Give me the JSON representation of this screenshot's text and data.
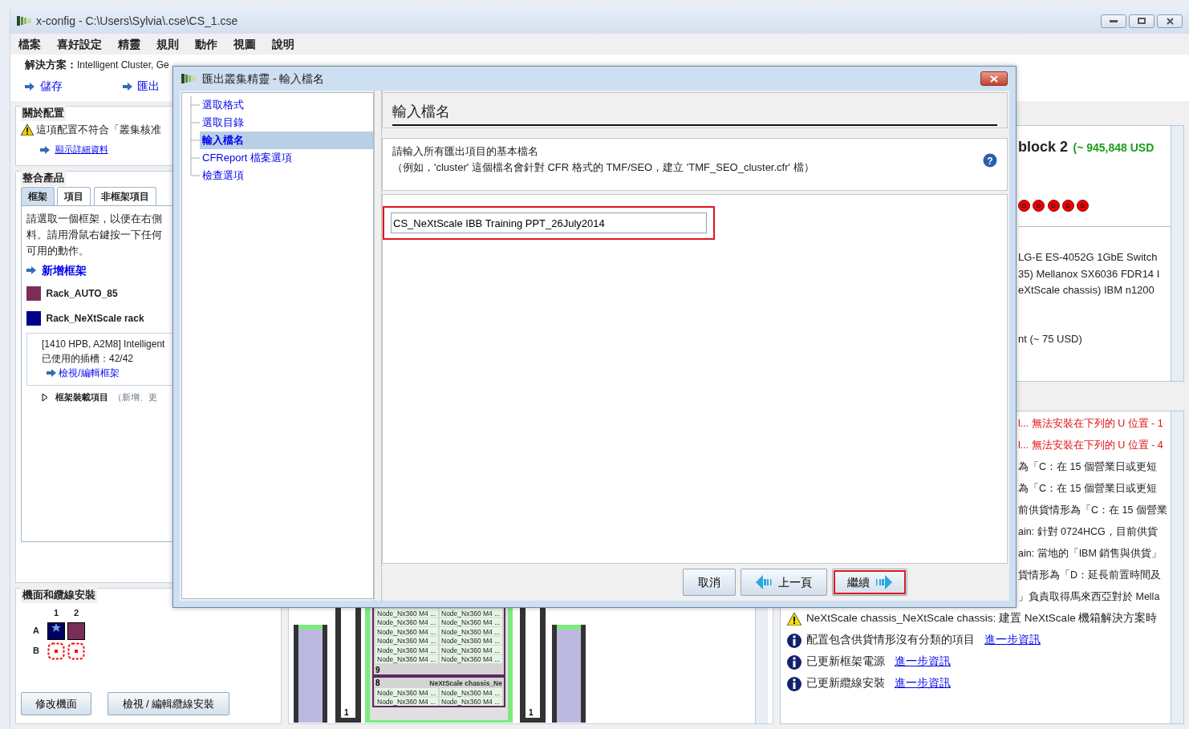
{
  "window": {
    "title": "x-config - C:\\Users\\Sylvia\\.cse\\CS_1.cse"
  },
  "menu": [
    "檔案",
    "喜好設定",
    "精靈",
    "規則",
    "動作",
    "視圖",
    "說明"
  ],
  "solution": {
    "label": "解決方案：",
    "value": "Intelligent Cluster, Ge"
  },
  "actions": [
    "儲存",
    "匯出"
  ],
  "about": {
    "title": "關於配置",
    "warning": "這項配置不符合「叢集核准",
    "link": "顯示詳細資料"
  },
  "products": {
    "title": "整合產品",
    "tabs": [
      {
        "label": "框架",
        "selected": true
      },
      {
        "label": "項目",
        "selected": false
      },
      {
        "label": "非框架項目",
        "selected": false
      }
    ],
    "instructions": [
      "請選取一個框架，以便在右側",
      "料。請用滑鼠右鍵按一下任何",
      "可用的動作。"
    ],
    "add_link": "新增框架",
    "racks": [
      {
        "name": "Rack_AUTO_85",
        "color": "#7b2d5a"
      },
      {
        "name": "Rack_NeXtScale rack",
        "color": "#000088"
      }
    ],
    "rack_detail": {
      "model": "[1410 HPB, A2M8] Intelligent",
      "slots": "已使用的插槽：42/42",
      "link": "檢視/編輯框架"
    },
    "loaded_items": {
      "label": "框架裝載項目",
      "hint": "（新增、更",
      "expanded": false
    }
  },
  "floor": {
    "title": "機面和纜線安裝",
    "columns": [
      "1",
      "2"
    ],
    "rows": [
      {
        "label": "A",
        "cells": [
          {
            "kind": "rack",
            "color": "#000060",
            "starred": true
          },
          {
            "kind": "rack",
            "color": "#7b2d5a",
            "starred": false
          }
        ]
      },
      {
        "label": "B",
        "cells": [
          {
            "kind": "empty"
          },
          {
            "kind": "empty"
          }
        ]
      }
    ],
    "buttons": [
      "修改機面",
      "檢視 / 編輯纜線安裝"
    ]
  },
  "rack_view": {
    "racks": [
      {
        "kind": "empty"
      },
      {
        "kind": "narrow",
        "number": "1"
      },
      {
        "kind": "chassis",
        "chassis": [
          {
            "number": "9",
            "nodes": [
              "Node_Nx360 M4 ...",
              "Node_Nx360 M4 ...",
              "Node_Nx360 M4 ...",
              "Node_Nx360 M4 ...",
              "Node_Nx360 M4 ...",
              "Node_Nx360 M4 ...",
              "Node_Nx360 M4 ...",
              "Node_Nx360 M4 ...",
              "Node_Nx360 M4 ...",
              "Node_Nx360 M4 ...",
              "Node_Nx360 M4 ...",
              "Node_Nx360 M4 ..."
            ]
          },
          {
            "number": "8",
            "title": "NeXtScale chassis_Ne",
            "nodes": [
              "Node_Nx360 M4 ...",
              "Node_Nx360 M4 ...",
              "Node_Nx360 M4 ...",
              "Node_Nx360 M4 ..."
            ]
          }
        ]
      },
      {
        "kind": "narrow",
        "number": "1"
      },
      {
        "kind": "empty"
      }
    ]
  },
  "summary": {
    "title": "block 2",
    "price": "(~ 945,848 USD",
    "markers": [
      "D",
      "D",
      "D",
      "D",
      "D"
    ],
    "lines": [
      "LG-E ES-4052G 1GbE Switch",
      "35) Mellanox SX6036 FDR14 I",
      "eXtScale chassis) IBM n1200",
      "nt (~ 75 USD)"
    ]
  },
  "messages": {
    "partial": [
      {
        "kind": "error",
        "text": "l... 無法安裝在下列的 U 位置 - 1"
      },
      {
        "kind": "error",
        "text": "l... 無法安裝在下列的 U 位置 - 4"
      },
      {
        "kind": "note",
        "text": "為「C：在 15 個營業日或更短"
      },
      {
        "kind": "note",
        "text": "為「C：在 15 個營業日或更短"
      },
      {
        "kind": "note",
        "text": "前供貨情形為「C：在 15 個營業"
      },
      {
        "kind": "note",
        "text": "ain: 針對 0724HCG，目前供貨"
      },
      {
        "kind": "note",
        "text": "ain: 當地的「IBM 銷售與供貨」"
      },
      {
        "kind": "note",
        "text": "貨情形為「D：延長前置時間及"
      },
      {
        "kind": "note",
        "text": "」負責取得馬來西亞對於 Mella"
      }
    ],
    "full": [
      {
        "kind": "warning",
        "text": "NeXtScale chassis_NeXtScale chassis: 建置 NeXtScale 機箱解決方案時"
      },
      {
        "kind": "info",
        "text": "配置包含供貨情形沒有分類的項目",
        "link": "進一步資訊"
      },
      {
        "kind": "info",
        "text": "已更新框架電源",
        "link": "進一步資訊"
      },
      {
        "kind": "info",
        "text": "已更新纜線安裝",
        "link": "進一步資訊"
      }
    ]
  },
  "dialog": {
    "title": "匯出叢集精靈 - 輸入檔名",
    "steps": [
      {
        "label": "選取格式",
        "selected": false
      },
      {
        "label": "選取目錄",
        "selected": false
      },
      {
        "label": "輸入檔名",
        "selected": true
      },
      {
        "label": "CFReport 檔案選項",
        "selected": false
      },
      {
        "label": "檢查選項",
        "selected": false
      }
    ],
    "heading": "輸入檔名",
    "help_symbol": "?",
    "description": [
      "請輸入所有匯出項目的基本檔名",
      "（例如，'cluster' 這個檔名會針對 CFR 格式的 TMF/SEO，建立 'TMF_SEO_cluster.cfr' 檔）"
    ],
    "filename": {
      "value": "CS_NeXtScale IBB Training PPT_26July2014",
      "highlighted": true
    },
    "buttons": [
      {
        "label": "取消",
        "kind": "cancel",
        "highlighted": false
      },
      {
        "label": "上一頁",
        "kind": "back",
        "highlighted": false
      },
      {
        "label": "繼續",
        "kind": "next",
        "highlighted": true
      }
    ]
  }
}
